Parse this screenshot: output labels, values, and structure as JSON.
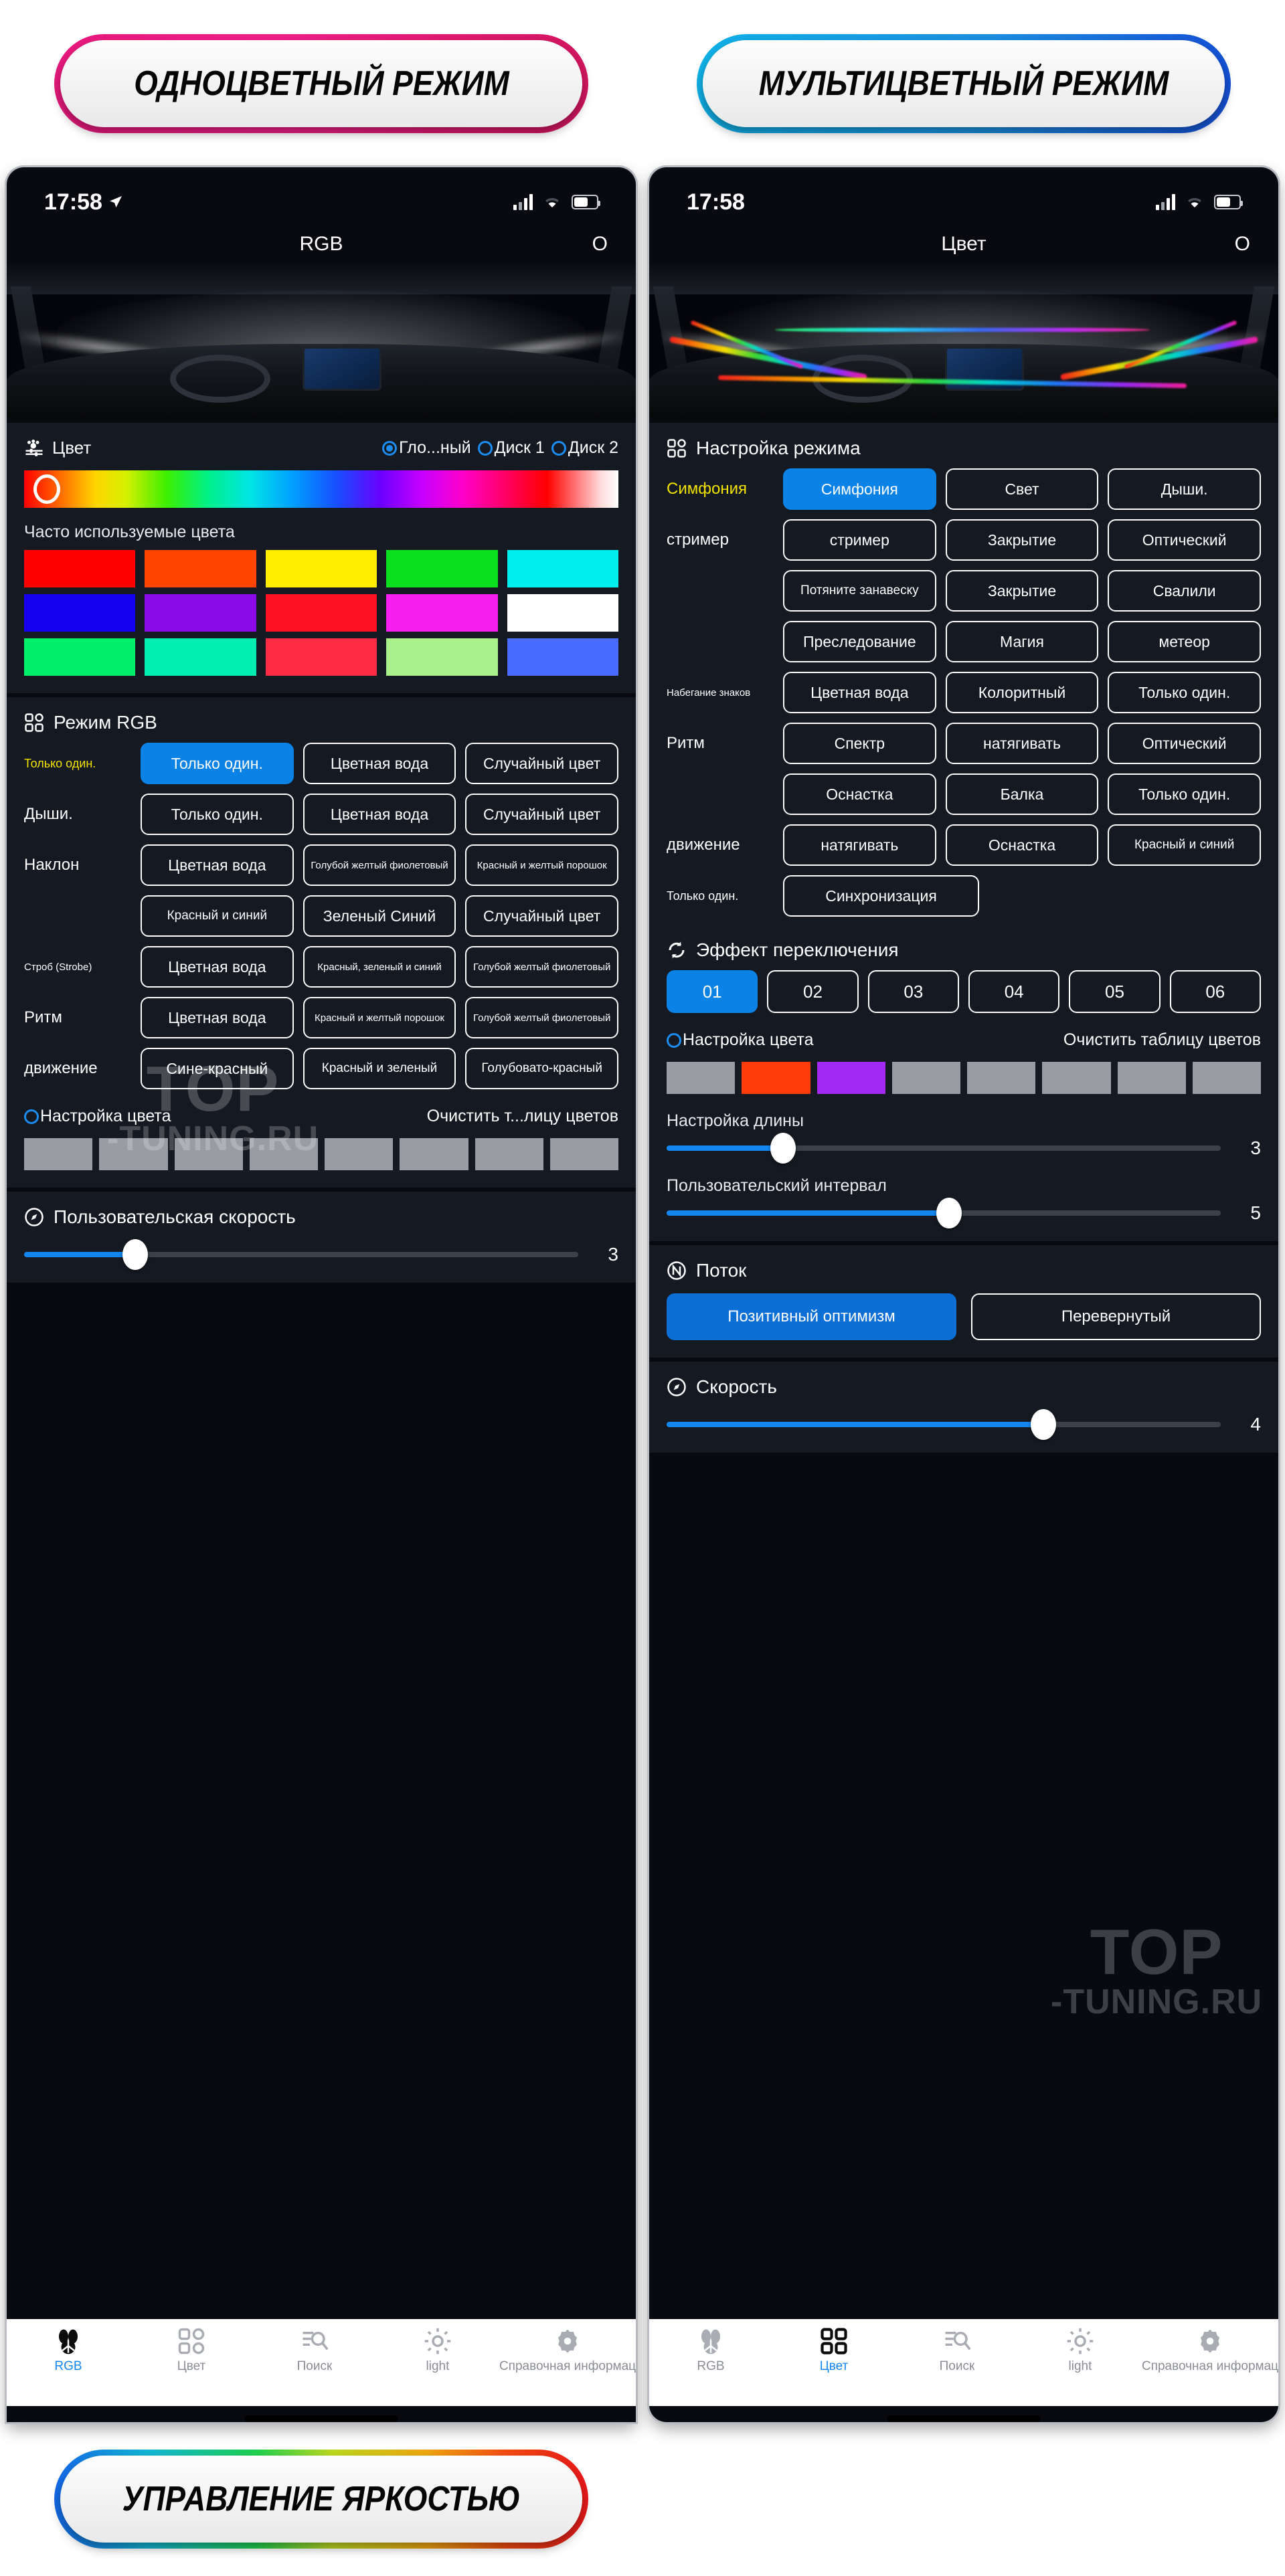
{
  "badges": {
    "left": "ОДНОЦВЕТНЫЙ РЕЖИМ",
    "right": "МУЛЬТИЦВЕТНЫЙ РЕЖИМ",
    "bottom": "УПРАВЛЕНИЕ ЯРКОСТЬЮ"
  },
  "watermark": {
    "line1": "TOP",
    "line2": "-TUNING.RU"
  },
  "colors": {
    "accent_blue": "#1486f0",
    "selected_blue": "#0b82e6",
    "highlight_yellow": "#f2e200",
    "panel_bg": "#151a22",
    "phone_bg": "#080a10"
  },
  "left_phone": {
    "status": {
      "time": "17:58",
      "location_icon": "location-arrow-icon",
      "signal_icon": "signal-bars-icon",
      "wifi_icon": "wifi-icon",
      "battery_icon": "battery-icon"
    },
    "nav": {
      "title": "RGB",
      "right_action": "O"
    },
    "color_card": {
      "icon": "color-slider-icon",
      "title": "Цвет",
      "options": [
        {
          "label": "Гло...ный",
          "selected": true
        },
        {
          "label": "Диск 1",
          "selected": false
        },
        {
          "label": "Диск 2",
          "selected": false
        }
      ],
      "frequent_label": "Часто используемые цвета",
      "swatches": [
        "#ff0000",
        "#ff4400",
        "#ffee00",
        "#0bdf1e",
        "#00eeee",
        "#1500ee",
        "#8a0ae8",
        "#ff1122",
        "#f61ef0",
        "#ffffff",
        "#00f06a",
        "#00efb0",
        "#ff2b47",
        "#a8f08a",
        "#4a6bff"
      ]
    },
    "rgb_mode_card": {
      "icon": "grid-icon",
      "title": "Режим RGB",
      "rows": [
        {
          "name": "Только один.",
          "highlight": true,
          "buttons": [
            {
              "label": "Только один.",
              "selected": true
            },
            {
              "label": "Цветная вода",
              "selected": false
            },
            {
              "label": "Случайный цвет",
              "selected": false
            }
          ]
        },
        {
          "name": "Дыши.",
          "highlight": false,
          "buttons": [
            {
              "label": "Только один.",
              "selected": false
            },
            {
              "label": "Цветная вода",
              "selected": false
            },
            {
              "label": "Случайный цвет",
              "selected": false
            }
          ]
        },
        {
          "name": "Наклон",
          "highlight": false,
          "buttons": [
            {
              "label": "Цветная вода",
              "selected": false
            },
            {
              "label": "Голубой желтый фиолетовый",
              "selected": false
            },
            {
              "label": "Красный и желтый порошок",
              "selected": false
            }
          ]
        },
        {
          "name": "",
          "highlight": false,
          "buttons": [
            {
              "label": "Красный и синий",
              "selected": false
            },
            {
              "label": "Зеленый Синий",
              "selected": false
            },
            {
              "label": "Случайный цвет",
              "selected": false
            }
          ]
        },
        {
          "name": "Строб (Strobe)",
          "highlight": false,
          "buttons": [
            {
              "label": "Цветная вода",
              "selected": false
            },
            {
              "label": "Красный, зеленый и синий",
              "selected": false
            },
            {
              "label": "Голубой желтый фиолетовый",
              "selected": false
            }
          ]
        },
        {
          "name": "Ритм",
          "highlight": false,
          "buttons": [
            {
              "label": "Цветная вода",
              "selected": false
            },
            {
              "label": "Красный и желтый порошок",
              "selected": false
            },
            {
              "label": "Голубой желтый фиолетовый",
              "selected": false
            }
          ]
        },
        {
          "name": "движение",
          "highlight": false,
          "buttons": [
            {
              "label": "Сине-красный",
              "selected": false
            },
            {
              "label": "Красный и зеленый",
              "selected": false
            },
            {
              "label": "Голубовато-красный",
              "selected": false
            }
          ]
        }
      ],
      "color_setup_label": "Настройка цвета",
      "clear_table_label": "Очистить т...лицу цветов",
      "table_cells": [
        "#9a9ca3",
        "#9a9ca3",
        "#9a9ca3",
        "#9a9ca3",
        "#9a9ca3",
        "#9a9ca3",
        "#9a9ca3",
        "#9a9ca3"
      ]
    },
    "speed_card": {
      "icon": "compass-icon",
      "title": "Пользовательская скорость",
      "value": "3",
      "fill_percent": 20
    },
    "tabs": [
      {
        "label": "RGB",
        "icon": "paw-icon",
        "active": true
      },
      {
        "label": "Цвет",
        "icon": "grid-icon",
        "active": false
      },
      {
        "label": "Поиск",
        "icon": "search-list-icon",
        "active": false
      },
      {
        "label": "light",
        "icon": "brightness-icon",
        "active": false
      },
      {
        "label": "Справочная информац",
        "icon": "gear-icon",
        "active": false
      }
    ]
  },
  "right_phone": {
    "status": {
      "time": "17:58",
      "signal_icon": "signal-bars-icon",
      "wifi_icon": "wifi-icon",
      "battery_icon": "battery-icon"
    },
    "nav": {
      "title": "Цвет",
      "right_action": "O"
    },
    "mode_card": {
      "icon": "grid-icon",
      "title": "Настройка режима",
      "rows": [
        {
          "name": "Симфония",
          "highlight": true,
          "buttons": [
            {
              "label": "Симфония",
              "selected": true
            },
            {
              "label": "Свет",
              "selected": false
            },
            {
              "label": "Дыши.",
              "selected": false
            }
          ]
        },
        {
          "name": "стример",
          "highlight": false,
          "buttons": [
            {
              "label": "стример",
              "selected": false
            },
            {
              "label": "Закрытие",
              "selected": false
            },
            {
              "label": "Оптический",
              "selected": false
            }
          ]
        },
        {
          "name": "",
          "highlight": false,
          "buttons": [
            {
              "label": "Потяните занавеску",
              "selected": false
            },
            {
              "label": "Закрытие",
              "selected": false
            },
            {
              "label": "Свалили",
              "selected": false
            }
          ]
        },
        {
          "name": "",
          "highlight": false,
          "buttons": [
            {
              "label": "Преследование",
              "selected": false
            },
            {
              "label": "Магия",
              "selected": false
            },
            {
              "label": "метеор",
              "selected": false
            }
          ]
        },
        {
          "name": "Набегание знаков",
          "highlight": false,
          "buttons": [
            {
              "label": "Цветная вода",
              "selected": false
            },
            {
              "label": "Колоритный",
              "selected": false
            },
            {
              "label": "Только один.",
              "selected": false
            }
          ]
        },
        {
          "name": "Ритм",
          "highlight": false,
          "buttons": [
            {
              "label": "Спектр",
              "selected": false
            },
            {
              "label": "натягивать",
              "selected": false
            },
            {
              "label": "Оптический",
              "selected": false
            }
          ]
        },
        {
          "name": "",
          "highlight": false,
          "buttons": [
            {
              "label": "Оснастка",
              "selected": false
            },
            {
              "label": "Балка",
              "selected": false
            },
            {
              "label": "Только один.",
              "selected": false
            }
          ]
        },
        {
          "name": "движение",
          "highlight": false,
          "buttons": [
            {
              "label": "натягивать",
              "selected": false
            },
            {
              "label": "Оснастка",
              "selected": false
            },
            {
              "label": "Красный и синий",
              "selected": false
            }
          ]
        },
        {
          "name": "Только один.",
          "highlight": false,
          "buttons": [
            {
              "label": "Синхронизация",
              "selected": false
            }
          ]
        }
      ]
    },
    "switch_effect": {
      "icon": "refresh-icon",
      "title": "Эффект переключения",
      "numbers": [
        {
          "label": "01",
          "selected": true
        },
        {
          "label": "02",
          "selected": false
        },
        {
          "label": "03",
          "selected": false
        },
        {
          "label": "04",
          "selected": false
        },
        {
          "label": "05",
          "selected": false
        },
        {
          "label": "06",
          "selected": false
        }
      ],
      "color_setup_label": "Настройка цвета",
      "clear_table_label": "Очистить таблицу цветов",
      "table_cells": [
        "#9a9ca3",
        "#ff3c0a",
        "#a329f5",
        "#9a9ca3",
        "#9a9ca3",
        "#9a9ca3",
        "#9a9ca3",
        "#9a9ca3"
      ],
      "length_label": "Настройка длины",
      "length_value": "3",
      "length_fill_percent": 21,
      "interval_label": "Пользовательский интервал",
      "interval_value": "5",
      "interval_fill_percent": 51
    },
    "flow_card": {
      "icon": "n-circle-icon",
      "title": "Поток",
      "buttons": [
        {
          "label": "Позитивный оптимизм",
          "selected": true
        },
        {
          "label": "Перевернутый",
          "selected": false
        }
      ]
    },
    "speed_card": {
      "icon": "compass-icon",
      "title": "Скорость",
      "value": "4",
      "fill_percent": 68
    },
    "tabs": [
      {
        "label": "RGB",
        "icon": "paw-icon",
        "active": false
      },
      {
        "label": "Цвет",
        "icon": "grid-icon",
        "active": true
      },
      {
        "label": "Поиск",
        "icon": "search-list-icon",
        "active": false
      },
      {
        "label": "light",
        "icon": "brightness-icon",
        "active": false
      },
      {
        "label": "Справочная информац",
        "icon": "gear-icon",
        "active": false
      }
    ]
  }
}
